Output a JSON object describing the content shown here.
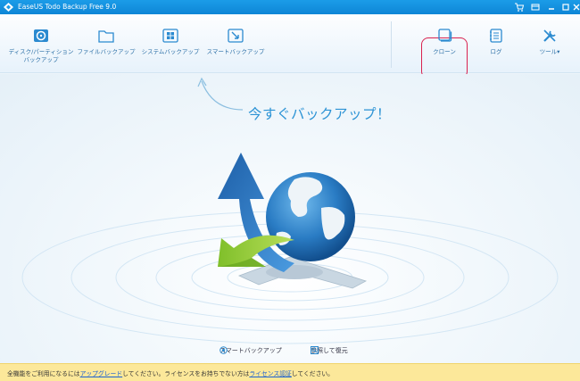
{
  "window": {
    "title": "EaseUS Todo Backup Free 9.0",
    "controls": [
      "cart-icon",
      "menu-icon",
      "minimize-icon",
      "maximize-icon",
      "close-icon"
    ]
  },
  "toolbar": {
    "left_tools": [
      {
        "label": "ディスク/パーティション\nバックアップ",
        "icon": "disk-backup-icon"
      },
      {
        "label": "ファイルバックアップ",
        "icon": "folder-icon"
      },
      {
        "label": "システムバックアップ",
        "icon": "windows-icon"
      },
      {
        "label": "スマートバックアップ",
        "icon": "smart-backup-icon"
      }
    ],
    "right_tools": [
      {
        "label": "クローン",
        "icon": "clone-icon",
        "highlighted": true
      },
      {
        "label": "ログ",
        "icon": "log-icon"
      },
      {
        "label": "ツール▾",
        "icon": "wrench-icon"
      }
    ]
  },
  "main": {
    "headline": "今すぐバックアップ！",
    "links": [
      {
        "label": "スマートバックアップ",
        "icon": "smart-backup-small-icon"
      },
      {
        "label": "参照して復元",
        "icon": "browse-restore-icon"
      }
    ]
  },
  "status_bar": {
    "text_1": "全機能をご利用になるには",
    "link_1": "アップグレード",
    "text_2": "してください。ライセンスをお持ちでない方は",
    "link_2": "ライセンス認証",
    "text_3": "してください。"
  },
  "colors": {
    "titlebar": "#1b9ce8",
    "accent": "#2c93d5",
    "highlight_border": "#d9214f",
    "status_bar": "#fce89a"
  }
}
